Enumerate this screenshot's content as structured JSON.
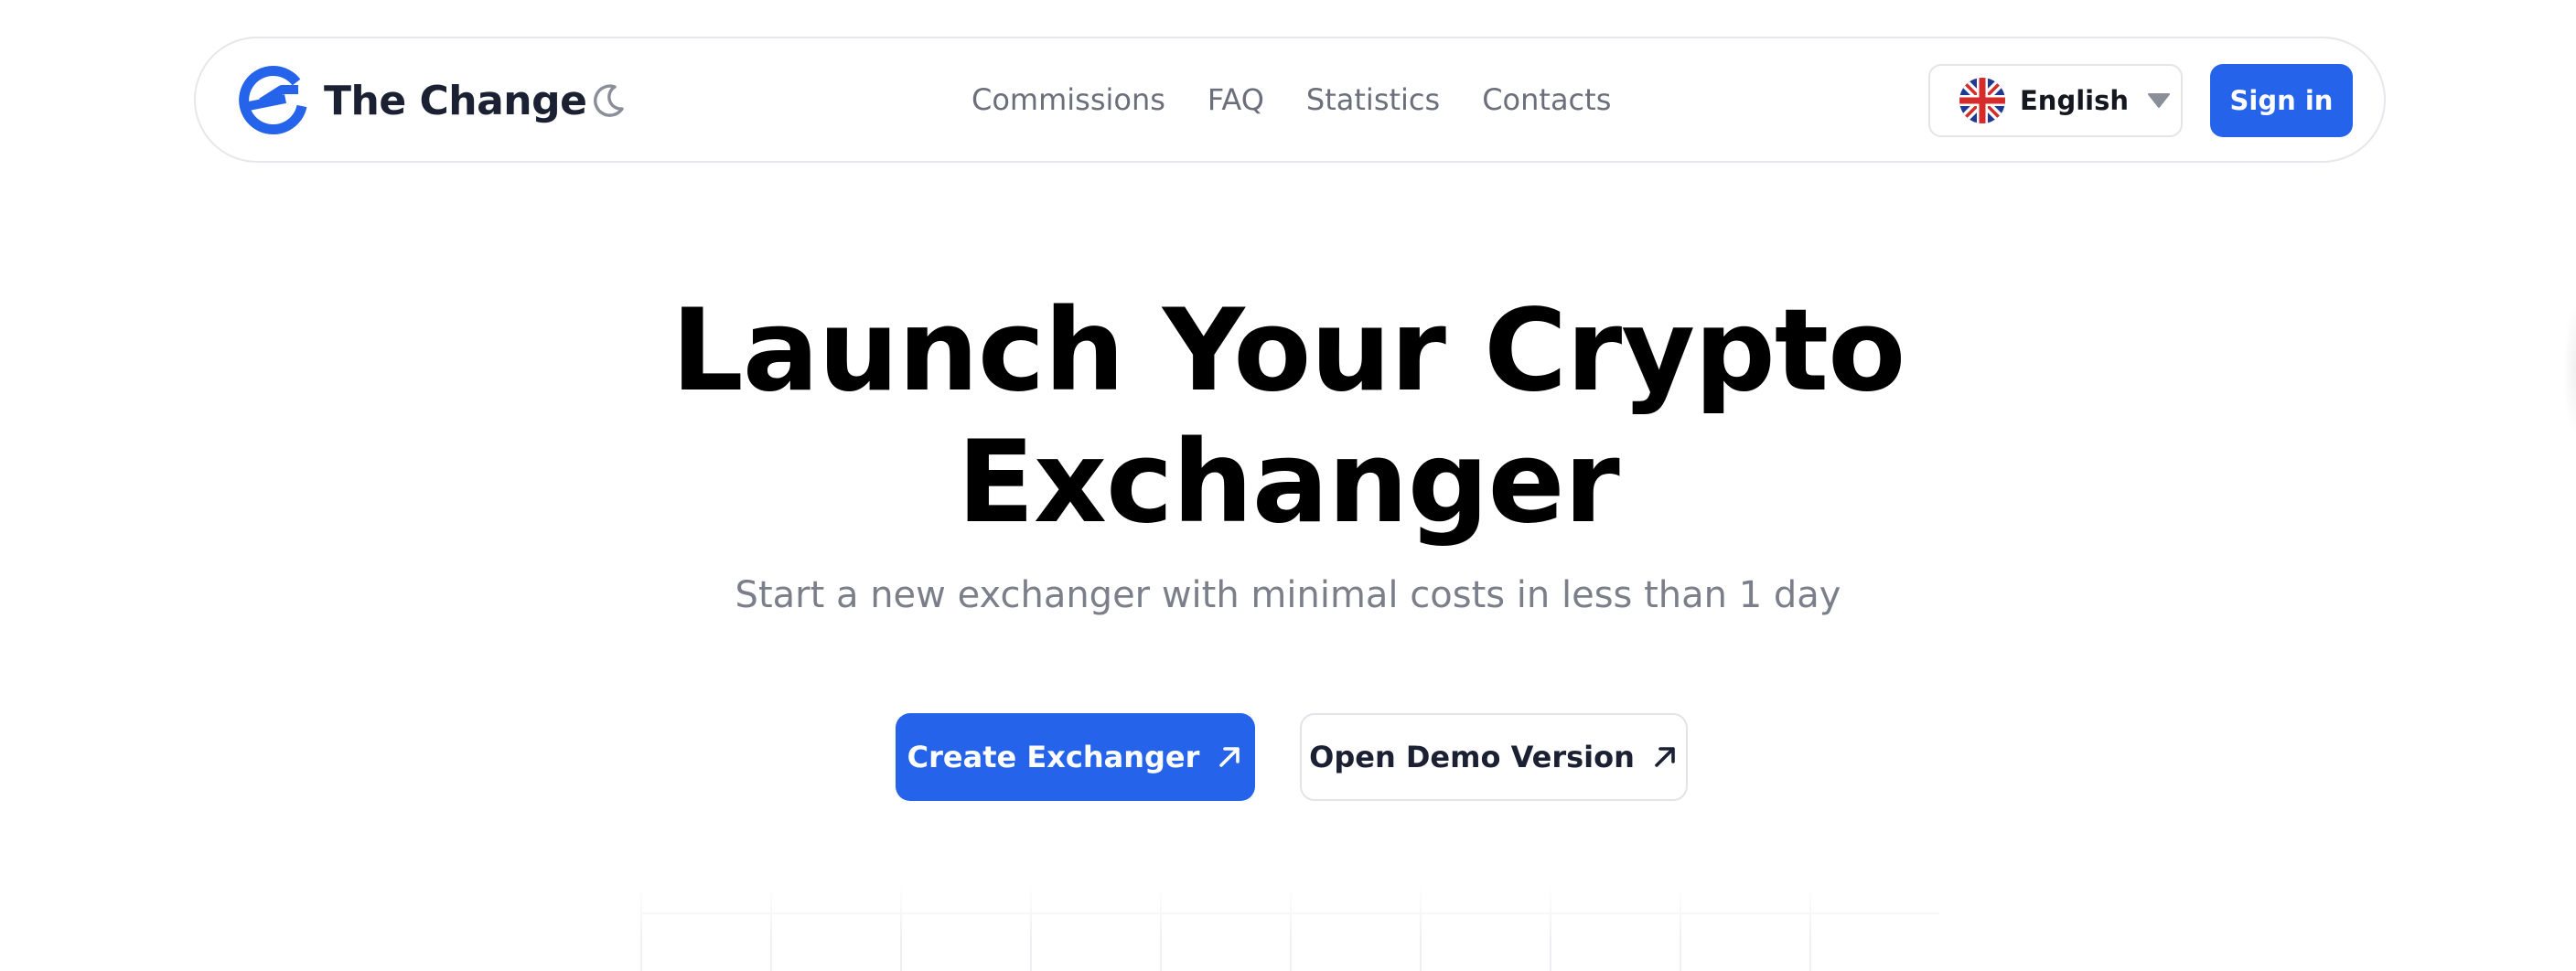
{
  "header": {
    "brand_name": "The Change",
    "logo_icon": "the-change-logo-icon",
    "theme_icon": "moon-icon",
    "nav": [
      {
        "label": "Commissions"
      },
      {
        "label": "FAQ"
      },
      {
        "label": "Statistics"
      },
      {
        "label": "Contacts"
      }
    ],
    "language": {
      "label": "English",
      "flag_icon": "uk-flag-icon",
      "caret_icon": "caret-down-icon"
    },
    "signin_label": "Sign in"
  },
  "hero": {
    "title_line1": "Launch Your Crypto",
    "title_line2": "Exchanger",
    "subtitle": "Start a new exchanger with minimal costs in less than 1 day",
    "primary_cta": "Create Exchanger",
    "secondary_cta": "Open Demo Version",
    "cta_icon": "arrow-up-right-icon"
  },
  "colors": {
    "accent": "#2563eb",
    "text_dark": "#1b2033",
    "text_muted": "#7b7f8a",
    "border": "#e6e7eb"
  }
}
